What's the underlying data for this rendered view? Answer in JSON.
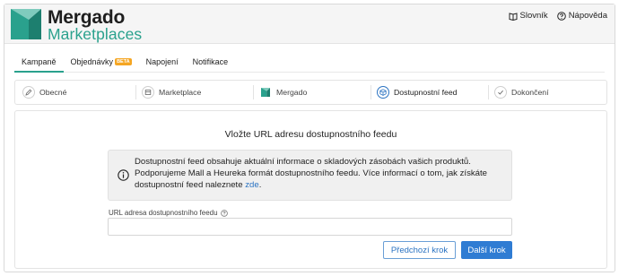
{
  "brand": {
    "name": "Mergado",
    "product": "Marketplaces",
    "accent_color": "#2aa18d"
  },
  "header": {
    "links": [
      {
        "label": "Slovník",
        "icon": "book-icon"
      },
      {
        "label": "Nápověda",
        "icon": "help-circle-icon"
      }
    ]
  },
  "tabs": [
    {
      "label": "Kampaně",
      "active": true
    },
    {
      "label": "Objednávky",
      "badge": "BETA"
    },
    {
      "label": "Napojení"
    },
    {
      "label": "Notifikace"
    }
  ],
  "steps": [
    {
      "label": "Obecné",
      "icon": "pencil-icon"
    },
    {
      "label": "Marketplace",
      "icon": "shop-icon"
    },
    {
      "label": "Mergado",
      "icon": "mergado-logo-icon"
    },
    {
      "label": "Dostupnostní feed",
      "icon": "box-icon",
      "active": true
    },
    {
      "label": "Dokončení",
      "icon": "check-icon"
    }
  ],
  "panel": {
    "title": "Vložte URL adresu dostupnostního feedu",
    "info_text": "Dostupnostní feed obsahuje aktuální informace o skladových zásobách vašich produktů. Podporujeme Mall a Heureka formát dostupnostního feedu. Více informací o tom, jak získáte dostupnostní feed naleznete",
    "info_link": "zde",
    "info_end": ".",
    "field_label": "URL adresa dostupnostního feedu",
    "field_value": "",
    "prev_button": "Předchozí krok",
    "next_button": "Další krok"
  },
  "colors": {
    "primary": "#2f7cd3",
    "badge": "#f5a623"
  }
}
